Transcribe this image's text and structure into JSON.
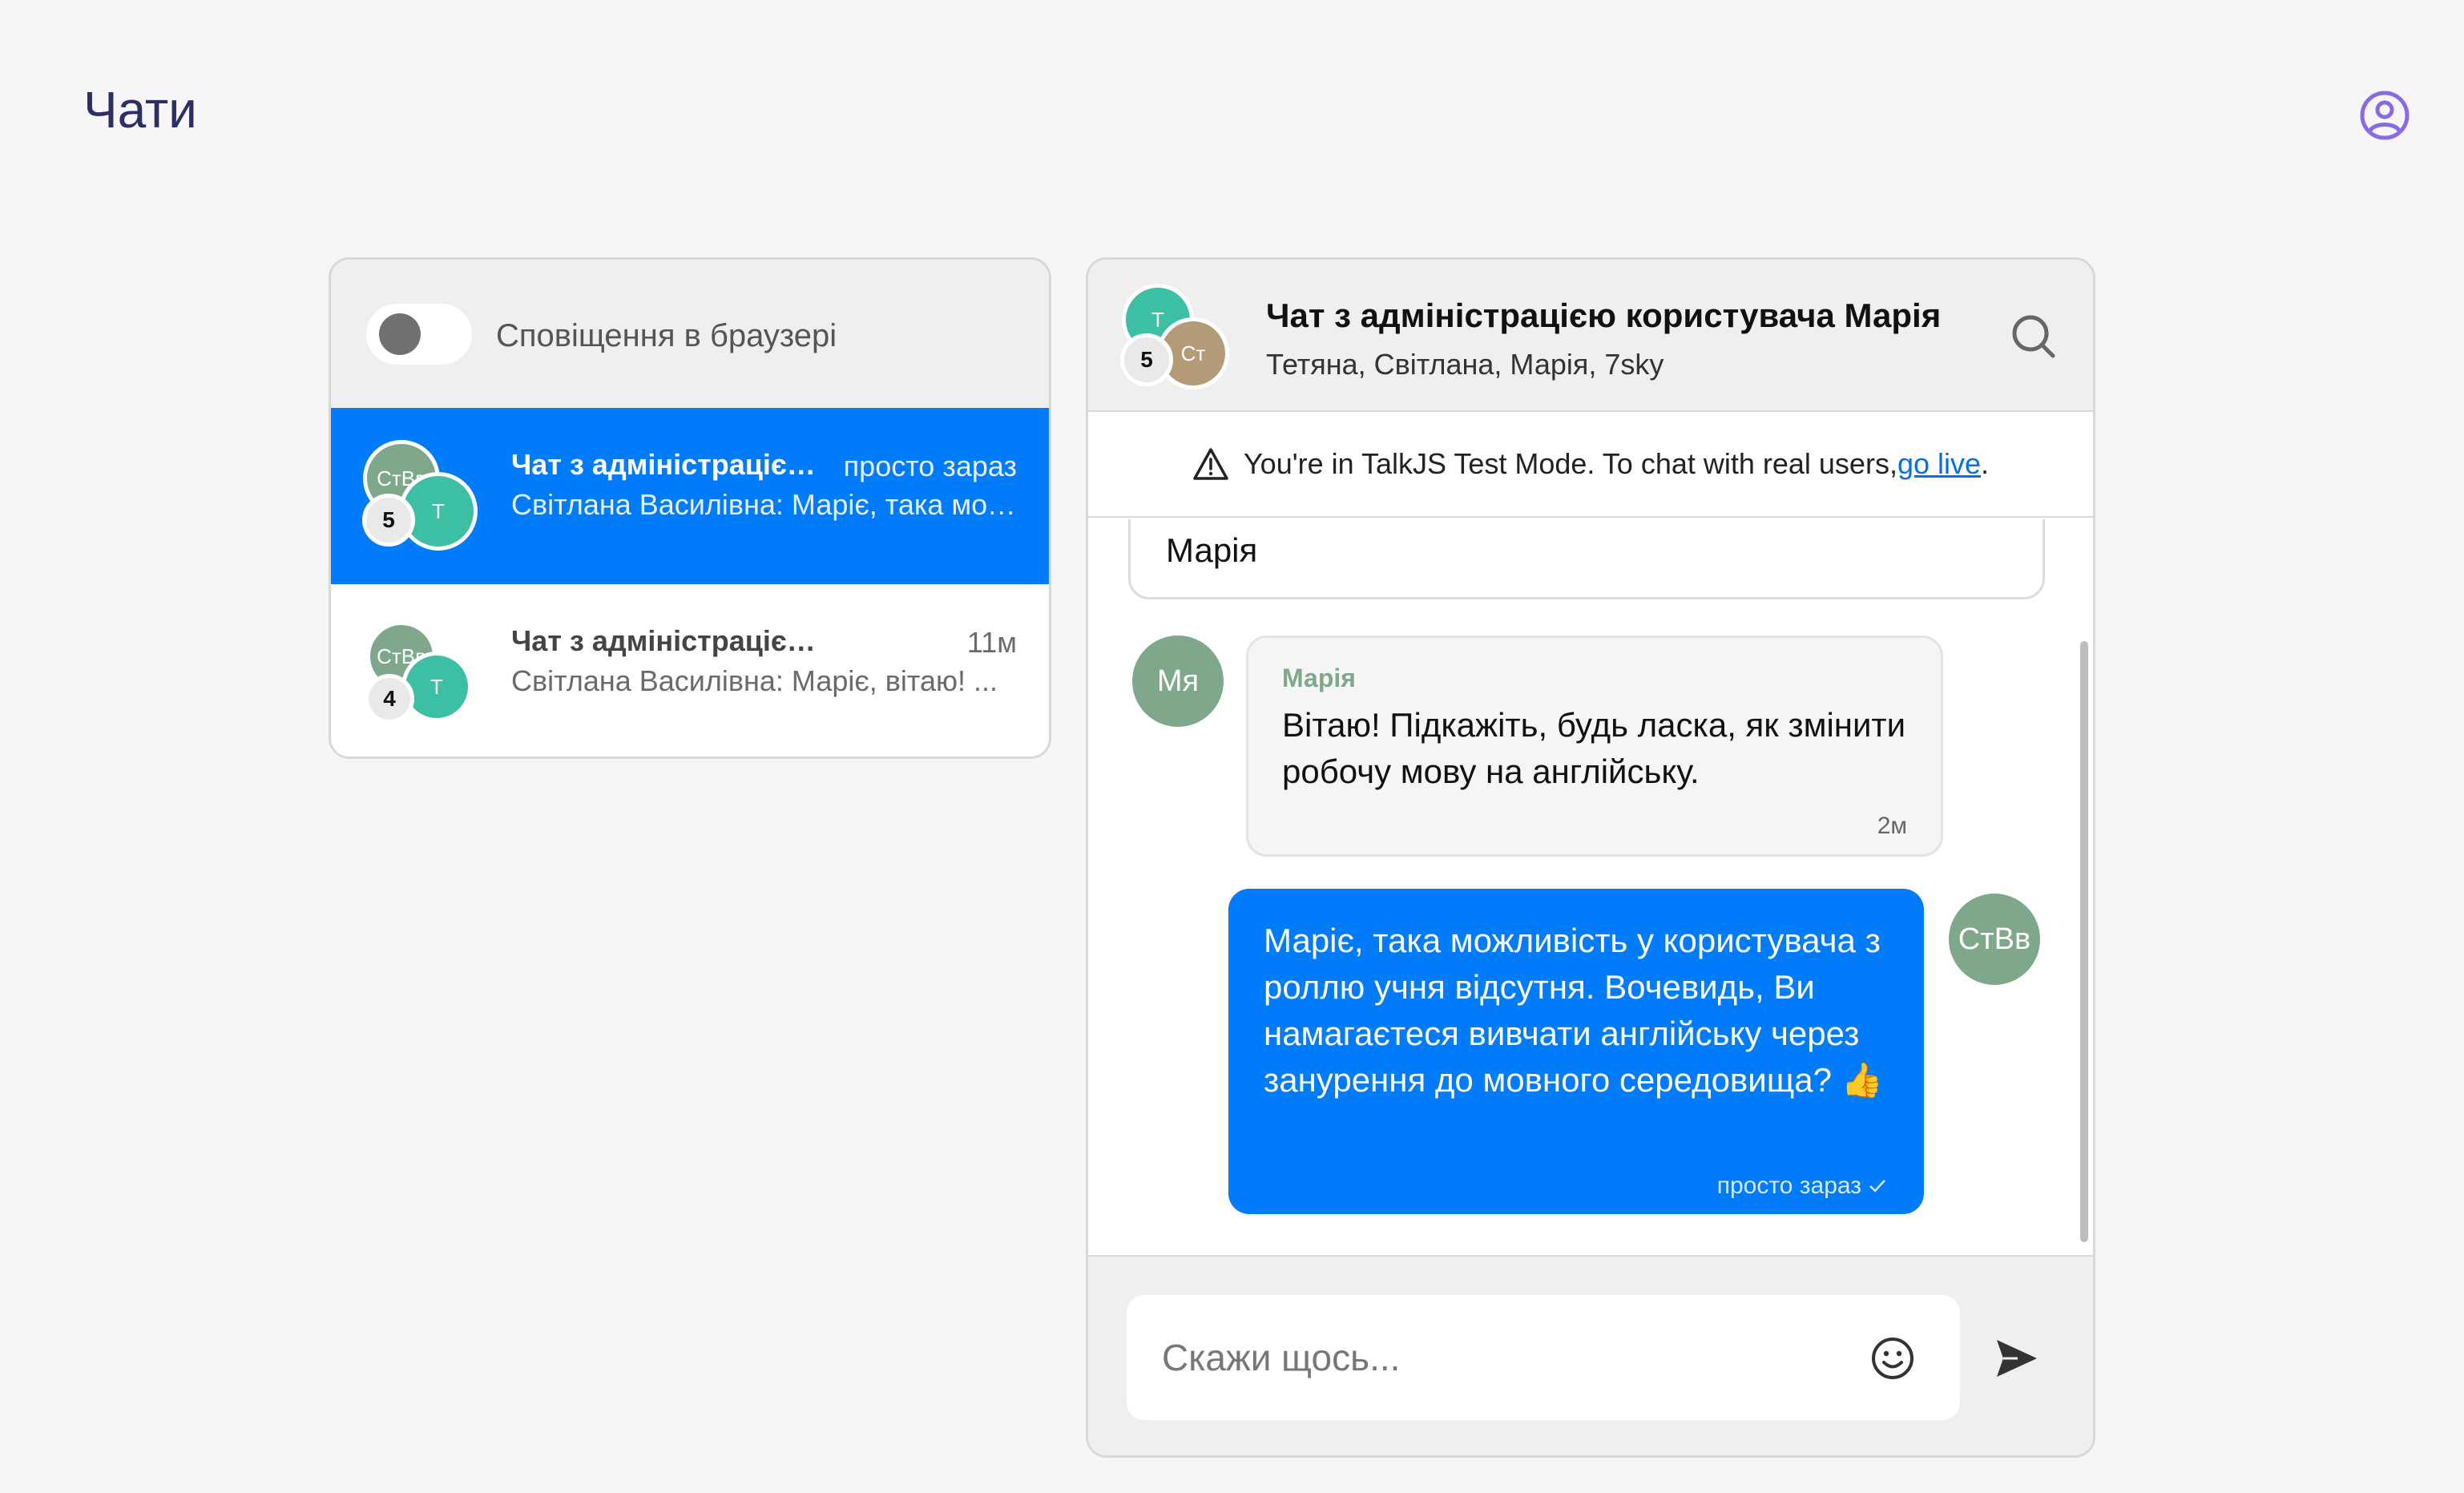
{
  "page": {
    "title": "Чати"
  },
  "icons": {
    "profile": "user-circle-icon",
    "search": "search-icon",
    "warning": "warning-triangle-icon",
    "emoji": "smiley-icon",
    "send": "send-icon",
    "read_check": "check-icon"
  },
  "colors": {
    "accent": "#007bfa",
    "title_color": "#2b2f63",
    "profile_icon": "#8a6ae2",
    "avatar_green": "#7fa88a",
    "avatar_teal": "#3dbfa3",
    "avatar_tan": "#b39b78"
  },
  "sidebar": {
    "notifications_label": "Сповіщення в браузері",
    "notifications_enabled": false,
    "conversations": [
      {
        "avatar_back": "СтВв",
        "avatar_front": "Т",
        "participant_count": "5",
        "title": "Чат з адміністрацією користувача Марія",
        "time": "просто зараз",
        "preview": "Світлана Василівна: Маріє, така можливість у користувача з роллю учня відсутня.",
        "selected": true
      },
      {
        "avatar_back": "СтВв",
        "avatar_front": "Т",
        "participant_count": "4",
        "title": "Чат з адміністрацією користувача",
        "time": "11м",
        "preview": "Світлана Василівна: Маріє, вітаю! ...",
        "selected": false
      }
    ]
  },
  "chat": {
    "header": {
      "avatar_top": "Т",
      "avatar_bottom": "Ст",
      "participant_count": "5",
      "title": "Чат з адміністрацією користувача Марія",
      "subtitle": "Тетяна, Світлана, Марія, 7sky"
    },
    "test_mode": {
      "text": "You're in TalkJS Test Mode. To chat with real users, ",
      "link": "go live",
      "suffix": "."
    },
    "previous_bubble_text": "Марія",
    "messages": [
      {
        "direction": "incoming",
        "avatar": "Мя",
        "sender": "Марія",
        "text": "Вітаю! Підкажіть, будь ласка, як змінити робочу мову на англійську.",
        "time": "2м"
      },
      {
        "direction": "outgoing",
        "avatar": "СтВв",
        "text": "Маріє, така можливість у користувача з роллю учня відсутня. Вочевидь, Ви намагаєтеся вивчати англійську через занурення до мовного середовища? 👍",
        "time": "просто зараз",
        "read": true
      }
    ],
    "composer": {
      "placeholder": "Скажи щось..."
    }
  }
}
